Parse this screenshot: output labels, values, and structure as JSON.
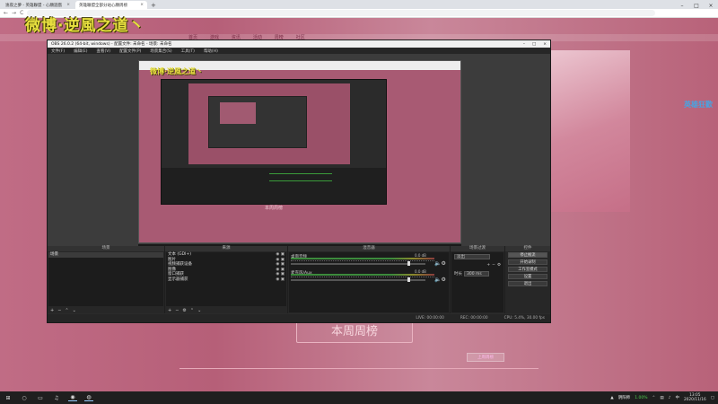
{
  "browser": {
    "tabs": [
      {
        "title": "逸夜之夢 - 英雄聯盟 - 心願遊戲",
        "active": false
      },
      {
        "title": "英雄聯盟全部分站心願周榜",
        "active": true
      }
    ],
    "new_tab": "+",
    "window_controls": [
      "–",
      "□",
      "×"
    ],
    "nav_back": "←",
    "nav_forward": "→",
    "nav_reload": "C"
  },
  "watermark": "微博·逆風之道丶",
  "page": {
    "nav_items": [
      "首页",
      "游戏",
      "资讯",
      "活动",
      "周榜",
      "社区"
    ],
    "ranking_title": "本周周榜",
    "online_button": "上周周榜",
    "corner_logo": "英雄狂歡"
  },
  "obs": {
    "title": "OBS 26.0.2 (64-bit, windows) - 配置文件: 未命名 - 场景: 未命名",
    "menu": [
      "文件(F)",
      "编辑(E)",
      "查看(V)",
      "配置文件(P)",
      "场景集合(S)",
      "工具(T)",
      "帮助(H)"
    ],
    "window_controls": [
      "–",
      "□",
      "×"
    ],
    "preview_watermark": "微博·逆風之道丶",
    "preview_banner": "本周周榜",
    "docks": {
      "scenes": {
        "header": "场景",
        "items": [
          "场景"
        ]
      },
      "sources": {
        "header": "来源",
        "items": [
          "文本 (GDI+)",
          "图片",
          "视频捕获设备",
          "图像",
          "窗口捕获",
          "显示器捕获"
        ]
      },
      "mixer": {
        "header": "混音器",
        "channels": [
          {
            "name": "桌面音频",
            "value": "0.0 dB"
          },
          {
            "name": "麦克风/Aux",
            "value": "0.0 dB"
          }
        ]
      },
      "transitions": {
        "header": "场景过渡",
        "mode": "淡出",
        "duration_label": "时长",
        "duration": "300 ms"
      },
      "controls": {
        "header": "控件",
        "buttons": [
          "停止推流",
          "开始录制",
          "工作室模式",
          "设置",
          "退出"
        ]
      }
    },
    "footer_buttons": [
      "+",
      "−",
      "⚙",
      "⌃",
      "⌄"
    ],
    "status": {
      "live": "LIVE: 00:00:00",
      "rec": "REC: 00:00:00",
      "cpu": "CPU: 5.4%, 30.00 fps"
    }
  },
  "taskbar": {
    "tray_game": "阴阳师",
    "tray_perf": "1.00%",
    "time": "13:05",
    "date": "2020/11/16"
  }
}
